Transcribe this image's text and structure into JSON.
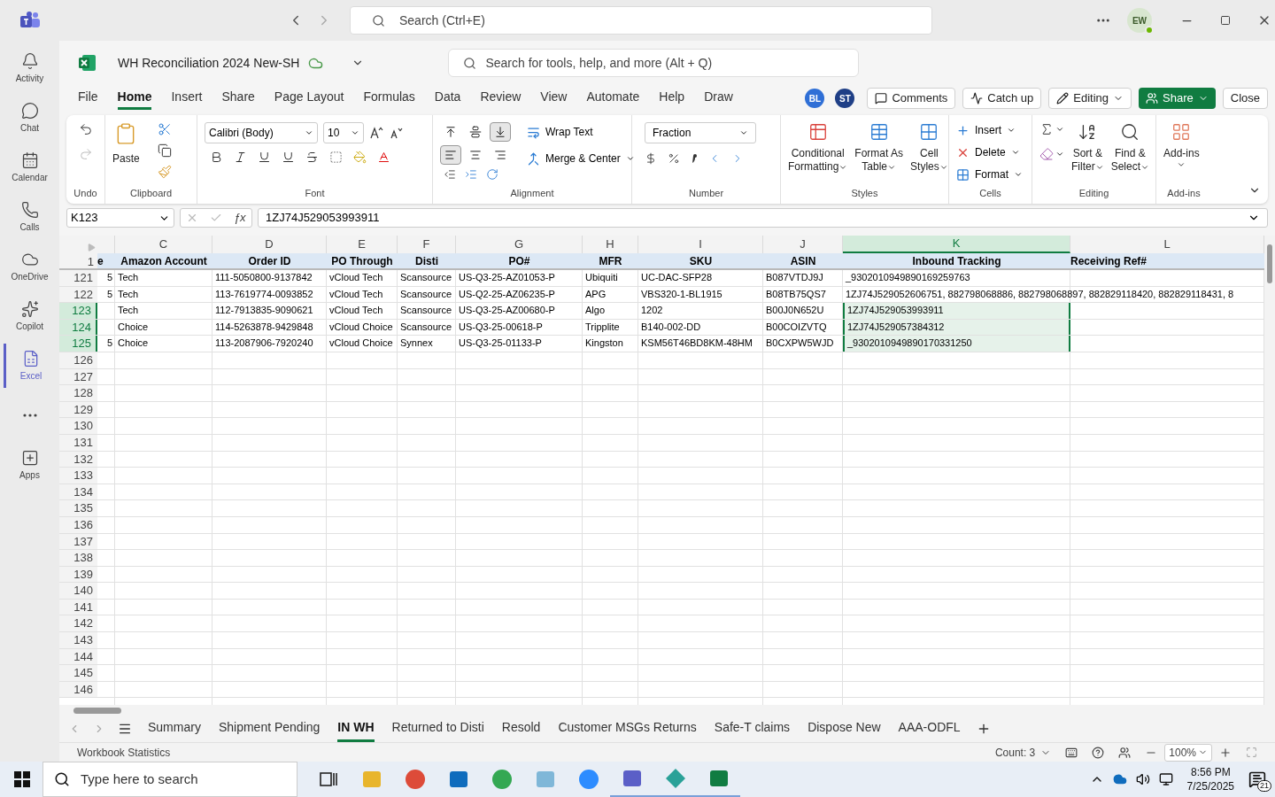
{
  "app_bar": {
    "search_placeholder": "Search (Ctrl+E)",
    "avatar": "EW"
  },
  "rail": [
    {
      "kind": "bell",
      "label": "Activity",
      "selected": false
    },
    {
      "kind": "chat",
      "label": "Chat",
      "selected": false
    },
    {
      "kind": "calendar",
      "label": "Calendar",
      "selected": false
    },
    {
      "kind": "phone",
      "label": "Calls",
      "selected": false
    },
    {
      "kind": "cloud",
      "label": "OneDrive",
      "selected": false
    },
    {
      "kind": "copilot",
      "label": "Copilot",
      "selected": false
    },
    {
      "kind": "excel",
      "label": "Excel",
      "selected": true
    },
    {
      "kind": "more",
      "selected": false
    },
    {
      "kind": "apps",
      "label": "Apps",
      "selected": false
    }
  ],
  "workbook": {
    "title": "WH Reconciliation 2024 New-SH",
    "search_placeholder": "Search for tools, help, and more (Alt + Q)"
  },
  "menu_tabs": [
    {
      "label": "File",
      "selected": false
    },
    {
      "label": "Home",
      "selected": true
    },
    {
      "label": "Insert",
      "selected": false
    },
    {
      "label": "Share",
      "selected": false
    },
    {
      "label": "Page Layout",
      "selected": false
    },
    {
      "label": "Formulas",
      "selected": false
    },
    {
      "label": "Data",
      "selected": false
    },
    {
      "label": "Review",
      "selected": false
    },
    {
      "label": "View",
      "selected": false
    },
    {
      "label": "Automate",
      "selected": false
    },
    {
      "label": "Help",
      "selected": false
    },
    {
      "label": "Draw",
      "selected": false
    }
  ],
  "collaborators": [
    {
      "initials": "BL",
      "color": "#2f6fd6"
    },
    {
      "initials": "ST",
      "color": "#1f3f86"
    }
  ],
  "actions": [
    {
      "kind": "comments",
      "label": "Comments"
    },
    {
      "kind": "catchup",
      "label": "Catch up"
    },
    {
      "kind": "editing",
      "label": "Editing"
    },
    {
      "kind": "share",
      "label": "Share"
    },
    {
      "kind": "close",
      "label": "Close"
    }
  ],
  "ribbon": {
    "undo": {
      "label": "Undo"
    },
    "clipboard": {
      "label": "Clipboard",
      "paste": "Paste"
    },
    "font": {
      "label": "Font",
      "family": "Calibri (Body)",
      "size": "10"
    },
    "alignment": {
      "label": "Alignment",
      "wrap": "Wrap Text",
      "merge": "Merge & Center",
      "vertical": [
        {
          "selected": false
        },
        {
          "selected": false
        },
        {
          "selected": true
        }
      ],
      "horizontal": [
        {
          "selected": true
        },
        {
          "selected": false
        },
        {
          "selected": false
        }
      ]
    },
    "number": {
      "label": "Number",
      "format": "Fraction"
    },
    "styles": {
      "label": "Styles",
      "buttons": [
        {
          "kind": "conditional",
          "line1": "Conditional",
          "line2": "Formatting"
        },
        {
          "kind": "table",
          "line1": "Format As",
          "line2": "Table"
        },
        {
          "kind": "cellstyles",
          "line1": "Cell",
          "line2": "Styles"
        }
      ]
    },
    "cells": {
      "label": "Cells",
      "buttons": [
        {
          "kind": "insert",
          "label": "Insert"
        },
        {
          "kind": "delete",
          "label": "Delete"
        },
        {
          "kind": "format",
          "label": "Format"
        }
      ]
    },
    "editing": {
      "label": "Editing",
      "buttons": [
        {
          "kind": "sort",
          "line1": "Sort &",
          "line2": "Filter"
        },
        {
          "kind": "find",
          "line1": "Find &",
          "line2": "Select"
        }
      ]
    },
    "addins": {
      "label": "Add-ins",
      "button": "Add-ins"
    }
  },
  "formula_bar": {
    "name_box": "K123",
    "fx": "ƒx",
    "value": "1ZJ74J529053993911"
  },
  "sheet": {
    "header_row": "1",
    "columns": [
      {
        "header": "e",
        "selected": false
      },
      {
        "letter": "C",
        "header": "Amazon Account",
        "selected": false
      },
      {
        "letter": "D",
        "header": "Order ID",
        "selected": false
      },
      {
        "letter": "E",
        "header": "PO Through",
        "selected": false
      },
      {
        "letter": "F",
        "header": "Disti",
        "selected": false
      },
      {
        "letter": "G",
        "header": "PO#",
        "selected": false
      },
      {
        "letter": "H",
        "header": "MFR",
        "selected": false
      },
      {
        "letter": "I",
        "header": "SKU",
        "selected": false
      },
      {
        "letter": "J",
        "header": "ASIN",
        "selected": false
      },
      {
        "letter": "K",
        "header": "Inbound Tracking",
        "selected": true
      },
      {
        "letter": "L",
        "header": "Receiving Ref#",
        "selected": false
      }
    ],
    "rows": [
      {
        "number": "121",
        "selected": false,
        "cells": [
          "5",
          "Tech",
          "111-5050800-9137842",
          "vCloud Tech",
          "Scansource",
          "US-Q3-25-AZ01053-P",
          "Ubiquiti",
          "UC-DAC-SFP28",
          "B087VTDJ9J",
          "_9302010949890169259763"
        ]
      },
      {
        "number": "122",
        "selected": false,
        "cells": [
          "5",
          "Tech",
          "113-7619774-0093852",
          "vCloud Tech",
          "Scansource",
          "US-Q2-25-AZ06235-P",
          "APG",
          "VBS320-1-BL1915",
          "B08TB75QS7",
          "1ZJ74J529052606751, 882798068886, 882798068897, 882829118420, 882829118431, 8"
        ]
      },
      {
        "number": "123",
        "selected": true,
        "cells": [
          null,
          "Tech",
          "112-7913835-9090621",
          "vCloud Tech",
          "Scansource",
          "US-Q3-25-AZ00680-P",
          "Algo",
          "1202",
          "B00J0N652U",
          "1ZJ74J529053993911"
        ]
      },
      {
        "number": "124",
        "selected": true,
        "cells": [
          null,
          "Choice",
          "114-5263878-9429848",
          "vCloud Choice",
          "Scansource",
          "US-Q3-25-00618-P",
          "Tripplite",
          "B140-002-DD",
          "B00COIZVTQ",
          "1ZJ74J529057384312"
        ]
      },
      {
        "number": "125",
        "selected": true,
        "cells": [
          "5",
          "Choice",
          "113-2087906-7920240",
          "vCloud Choice",
          "Synnex",
          "US-Q3-25-01133-P",
          "Kingston",
          "KSM56T46BD8KM-48HM",
          "B0CXPW5WJD",
          "_9302010949890170331250"
        ]
      },
      {
        "number": "126",
        "selected": false
      },
      {
        "number": "127",
        "selected": false
      },
      {
        "number": "128",
        "selected": false
      },
      {
        "number": "129",
        "selected": false
      },
      {
        "number": "130",
        "selected": false
      },
      {
        "number": "131",
        "selected": false
      },
      {
        "number": "132",
        "selected": false
      },
      {
        "number": "133",
        "selected": false
      },
      {
        "number": "134",
        "selected": false
      },
      {
        "number": "135",
        "selected": false
      },
      {
        "number": "136",
        "selected": false
      },
      {
        "number": "137",
        "selected": false
      },
      {
        "number": "138",
        "selected": false
      },
      {
        "number": "139",
        "selected": false
      },
      {
        "number": "140",
        "selected": false
      },
      {
        "number": "141",
        "selected": false
      },
      {
        "number": "142",
        "selected": false
      },
      {
        "number": "143",
        "selected": false
      },
      {
        "number": "144",
        "selected": false
      },
      {
        "number": "145",
        "selected": false
      },
      {
        "number": "146",
        "selected": false
      }
    ]
  },
  "sheet_tabs": [
    {
      "label": "Summary",
      "selected": false
    },
    {
      "label": "Shipment Pending",
      "selected": false
    },
    {
      "label": "IN WH",
      "selected": true
    },
    {
      "label": "Returned to Disti",
      "selected": false
    },
    {
      "label": "Resold",
      "selected": false
    },
    {
      "label": "Customer MSGs Returns",
      "selected": false
    },
    {
      "label": "Safe-T claims",
      "selected": false
    },
    {
      "label": "Dispose New",
      "selected": false
    },
    {
      "label": "AAA-ODFL",
      "selected": false
    }
  ],
  "status_bar": {
    "left": "Workbook Statistics",
    "count": "Count: 3",
    "zoom": "100%"
  },
  "taskbar": {
    "search_placeholder": "Type here to search",
    "time": "8:56 PM",
    "date": "7/25/2025",
    "notifications": "21"
  }
}
